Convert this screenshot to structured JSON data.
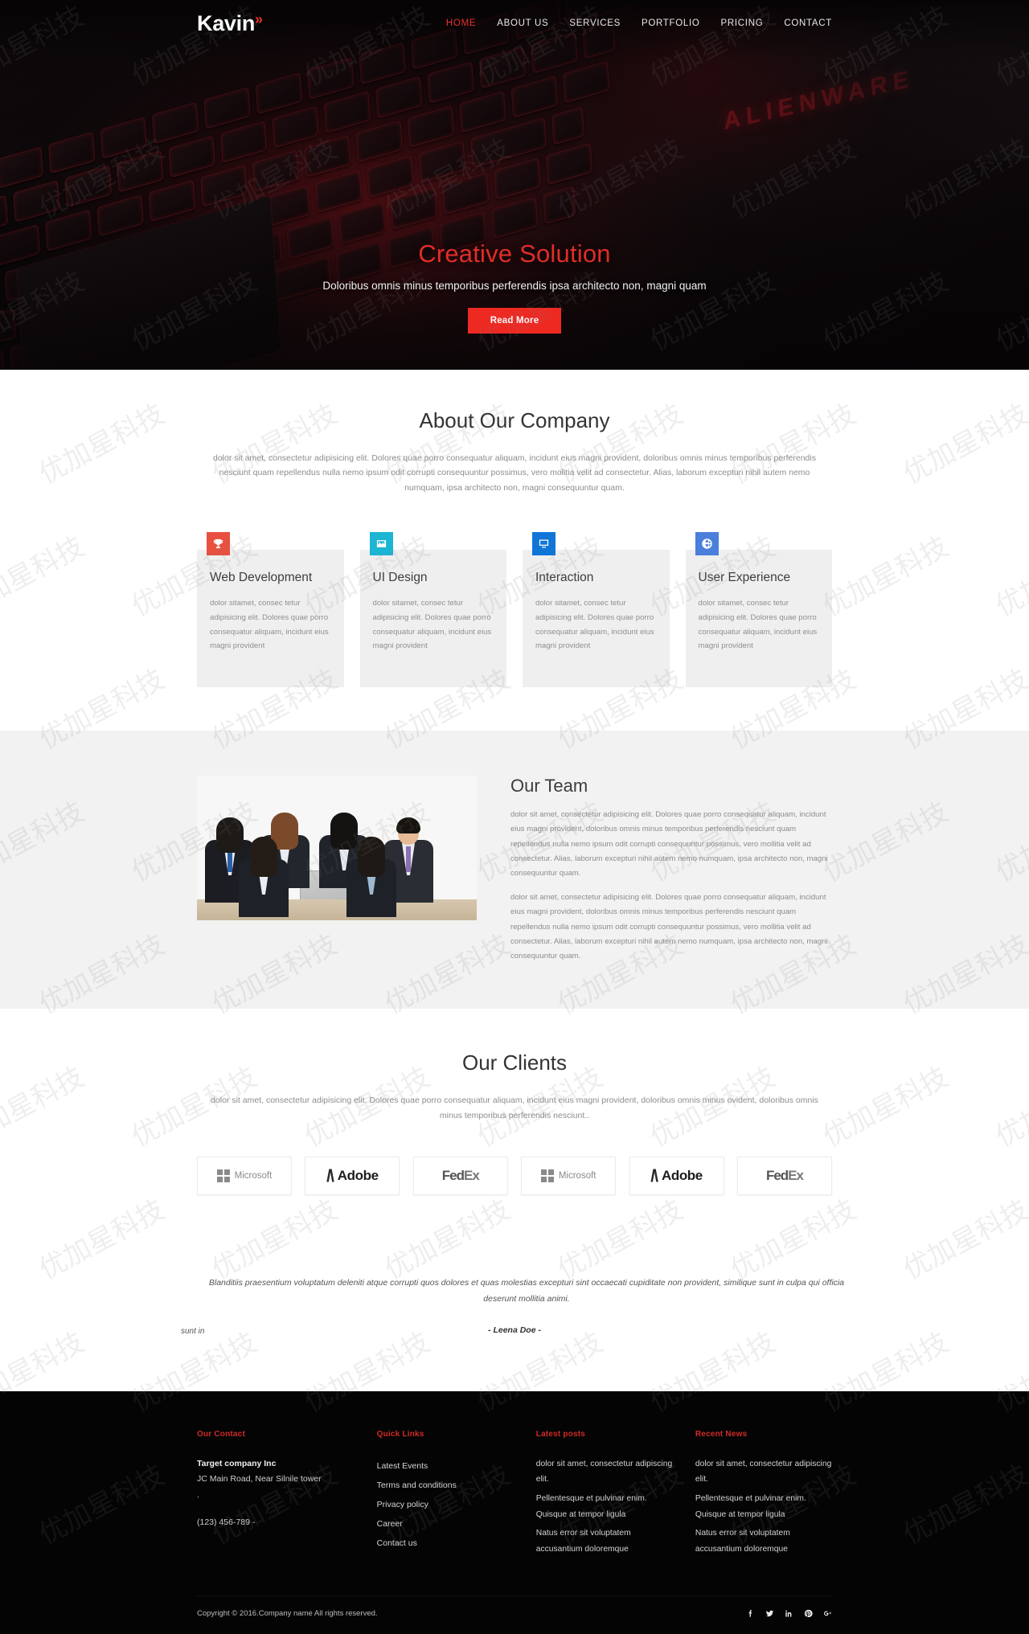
{
  "brand": {
    "name": "Kavin",
    "chevron": "»"
  },
  "nav": {
    "items": [
      {
        "label": "HOME",
        "active": true
      },
      {
        "label": "ABOUT US",
        "active": false
      },
      {
        "label": "SERVICES",
        "active": false
      },
      {
        "label": "PORTFOLIO",
        "active": false
      },
      {
        "label": "PRICING",
        "active": false
      },
      {
        "label": "CONTACT",
        "active": false
      }
    ]
  },
  "hero": {
    "title": "Creative Solution",
    "subtitle": "Doloribus omnis minus temporibus perferendis ipsa architecto non, magni quam",
    "button": "Read More",
    "bg_badge": "ALIENWARE",
    "accent": "#e02d28"
  },
  "about": {
    "title": "About Our Company",
    "lead": "dolor sit amet, consectetur adipisicing elit. Dolores quae porro consequatur aliquam, incidunt eius magni provident, doloribus omnis minus temporibus perferendis nesciunt quam repellendus nulla nemo ipsum odit corrupti consequuntur possimus, vero molitia velit ad consectetur. Alias, laborum excepturi nihil autem nemo numquam, ipsa architecto non, magni consequuntur quam.",
    "cards": [
      {
        "icon": "trophy-icon",
        "color": "#e8503f",
        "title": "Web Development",
        "text": "dolor sitamet, consec tetur adipisicing elit. Dolores quae porro consequatur aliquam, incidunt eius magni provident"
      },
      {
        "icon": "image-icon",
        "color": "#1cb5d4",
        "title": "UI Design",
        "text": "dolor sitamet, consec tetur adipisicing elit. Dolores quae porro consequatur aliquam, incidunt eius magni provident"
      },
      {
        "icon": "monitor-icon",
        "color": "#1175d8",
        "title": "Interaction",
        "text": "dolor sitamet, consec tetur adipisicing elit. Dolores quae porro consequatur aliquam, incidunt eius magni provident"
      },
      {
        "icon": "globe-icon",
        "color": "#4a7fdb",
        "title": "User Experience",
        "text": "dolor sitamet, consec tetur adipisicing elit. Dolores quae porro consequatur aliquam, incidunt eius magni provident"
      }
    ]
  },
  "team": {
    "title": "Our Team",
    "paragraph1": "dolor sit amet, consectetur adipisicing elit. Dolores quae porro consequatur aliquam, incidunt eius magni provident, doloribus omnis minus temporibus perferendis nesciunt quam repellendus nulla nemo ipsum odit corrupti consequuntur possimus, vero mollitia velit ad consectetur. Alias, laborum excepturi nihil autem nemo numquam, ipsa architecto non, magni consequuntur quam.",
    "paragraph2": "dolor sit amet, consectetur adipisicing elit. Dolores quae porro consequatur aliquam, incidunt eius magni provident, doloribus omnis minus temporibus perferendis nesciunt quam repellendus nulla nemo ipsum odit corrupti consequuntur possimus, vero mollitia velit ad consectetur. Alias, laborum excepturi nihil autem nemo numquam, ipsa architecto non, magni consequuntur quam.",
    "photo_alt": "team-photo"
  },
  "clients": {
    "title": "Our Clients",
    "lead": "dolor sit amet, consectetur adipisicing elit. Dolores quae porro consequatur aliquam, incidunt eius magni provident, doloribus omnis minus ovident, doloribus omnis minus temporibus perferendis nesciunt..",
    "logos": [
      {
        "kind": "microsoft",
        "label": "Microsoft"
      },
      {
        "kind": "adobe",
        "label": "Adobe"
      },
      {
        "kind": "fedex",
        "label": "FedEx"
      },
      {
        "kind": "microsoft",
        "label": "Microsoft"
      },
      {
        "kind": "adobe",
        "label": "Adobe"
      },
      {
        "kind": "fedex",
        "label": "FedEx"
      }
    ]
  },
  "testimonial": {
    "ghost": "sunt in",
    "quote": "Blanditiis praesentium voluptatum deleniti atque corrupti quos dolores et quas molestias excepturi sint occaecati cupiditate non provident, similique sunt in culpa qui officia deserunt mollitia animi.",
    "author": "- Leena Doe -"
  },
  "footer": {
    "contact": {
      "heading": "Our Contact",
      "company": "Target company Inc",
      "address": "JC Main Road, Near Silnile tower",
      "address2": ".",
      "phone": "(123) 456-789 -"
    },
    "quick_links": {
      "heading": "Quick Links",
      "items": [
        "Latest Events",
        "Terms and conditions",
        "Privacy policy",
        "Career",
        "Contact us"
      ]
    },
    "latest_posts": {
      "heading": "Latest posts",
      "items": [
        "dolor sit amet, consectetur adipiscing elit.",
        "Pellentesque et pulvinar enim. Quisque at tempor ligula",
        "Natus error sit voluptatem accusantium doloremque"
      ]
    },
    "recent_news": {
      "heading": "Recent News",
      "items": [
        "dolor sit amet, consectetur adipiscing elit.",
        "Pellentesque et pulvinar enim. Quisque at tempor ligula",
        "Natus error sit voluptatem accusantium doloremque"
      ]
    },
    "copyright": "Copyright © 2016.Company name All rights reserved.",
    "socials": [
      "facebook-icon",
      "twitter-icon",
      "linkedin-icon",
      "pinterest-icon",
      "googleplus-icon"
    ]
  },
  "watermark": {
    "text": "优加星科技"
  }
}
